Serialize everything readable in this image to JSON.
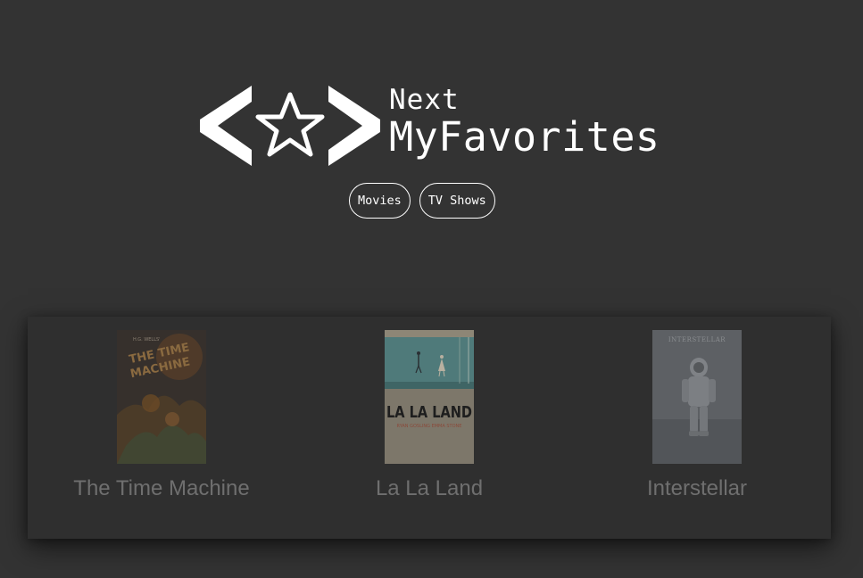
{
  "app": {
    "logo_line1": "Next",
    "logo_line2": "MyFavorites",
    "logo_icon": "code-star-icon"
  },
  "nav": {
    "movies_label": "Movies",
    "tvshows_label": "TV Shows"
  },
  "movies": [
    {
      "title": "The Time Machine",
      "poster_text": "THE TIME MACHINE",
      "poster_tag": "H.G. WELLS'"
    },
    {
      "title": "La La Land",
      "poster_text": "LA LA LAND",
      "poster_credit": "RYAN GOSLING   EMMA STONE"
    },
    {
      "title": "Interstellar",
      "poster_text": "INTERSTELLAR"
    }
  ],
  "colors": {
    "background": "#333333",
    "panel": "#2f2f2f",
    "text": "#ffffff",
    "muted_title": "#6f6f6f"
  }
}
